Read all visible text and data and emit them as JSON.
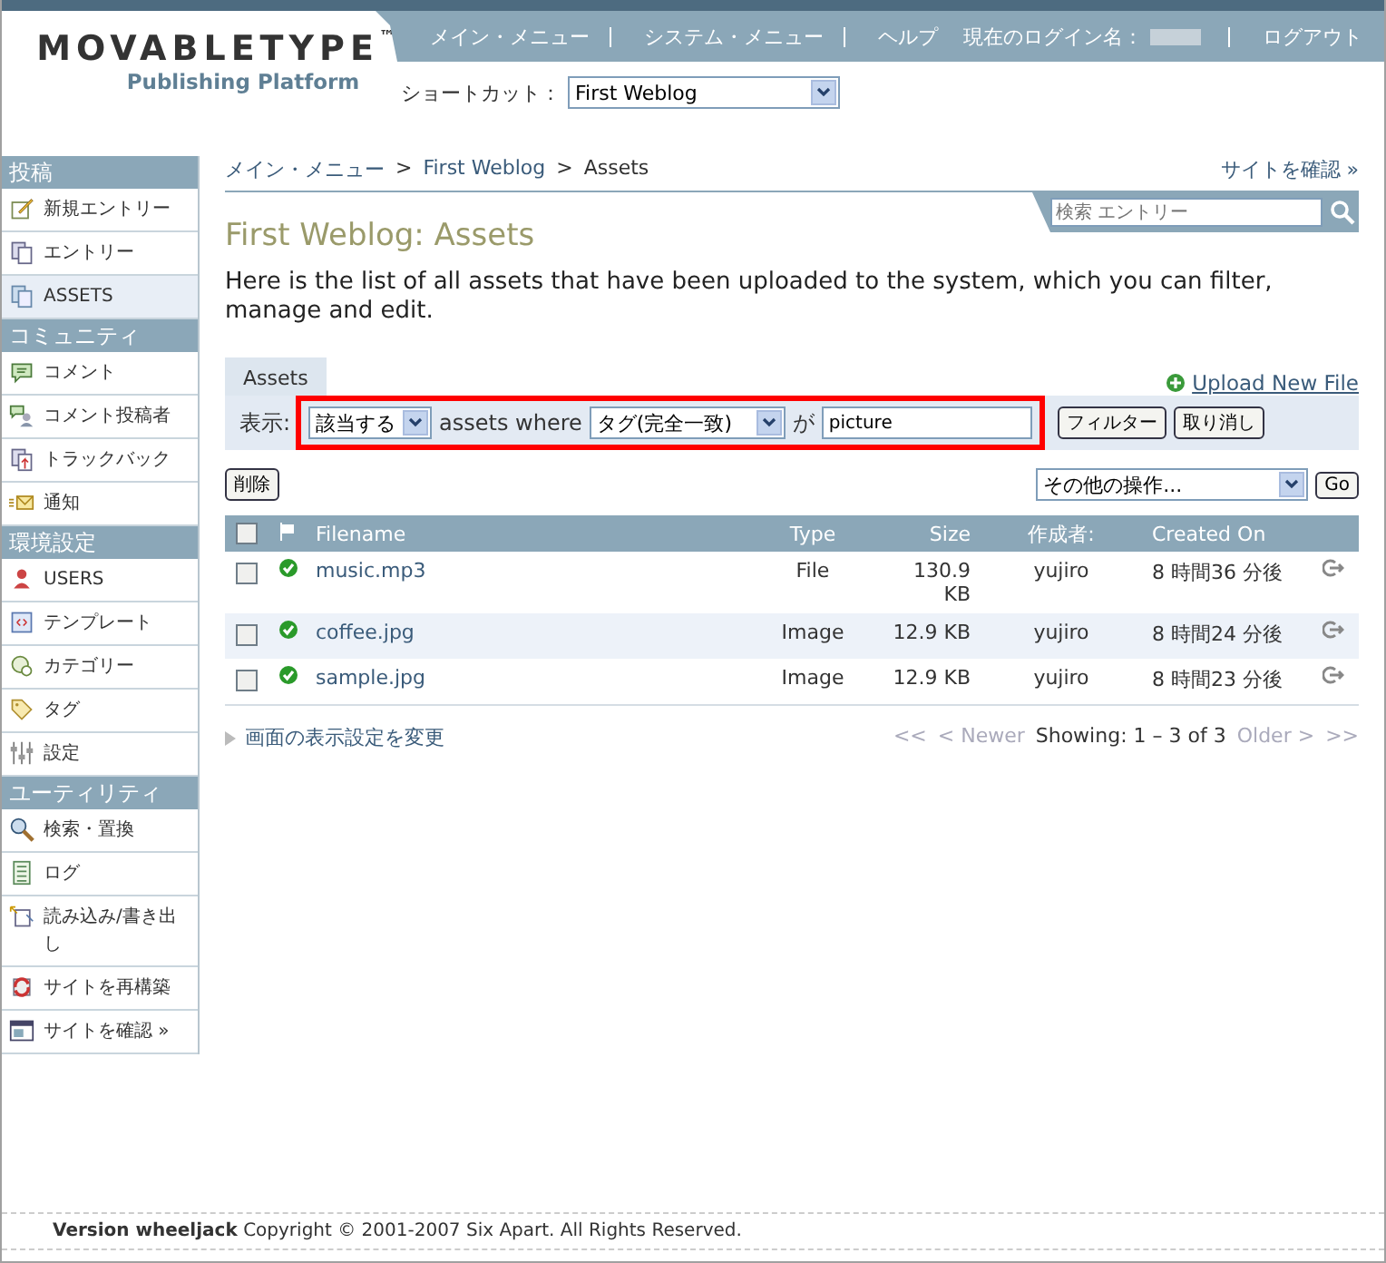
{
  "header": {
    "logo_title": "MOVABLETYPE",
    "logo_tm": "™",
    "logo_subtitle": "Publishing Platform",
    "nav": [
      "メイン・メニュー",
      "システム・メニュー",
      "ヘルプ"
    ],
    "login_label": "現在のログイン名：",
    "logout": "ログアウト",
    "shortcut_label": "ショートカット：",
    "shortcut_value": "First Weblog"
  },
  "sidebar": [
    {
      "title": "投稿",
      "items": [
        {
          "label": "新規エントリー",
          "selected": false
        },
        {
          "label": "エントリー",
          "selected": false
        },
        {
          "label": "ASSETS",
          "selected": true
        }
      ]
    },
    {
      "title": "コミュニティ",
      "items": [
        {
          "label": "コメント",
          "selected": false
        },
        {
          "label": "コメント投稿者",
          "selected": false
        },
        {
          "label": "トラックバック",
          "selected": false
        },
        {
          "label": "通知",
          "selected": false
        }
      ]
    },
    {
      "title": "環境設定",
      "items": [
        {
          "label": "USERS",
          "selected": false
        },
        {
          "label": "テンプレート",
          "selected": false
        },
        {
          "label": "カテゴリー",
          "selected": false
        },
        {
          "label": "タグ",
          "selected": false
        },
        {
          "label": "設定",
          "selected": false
        }
      ]
    },
    {
      "title": "ユーティリティ",
      "items": [
        {
          "label": "検索・置換",
          "selected": false
        },
        {
          "label": "ログ",
          "selected": false
        },
        {
          "label": "読み込み/書き出し",
          "selected": false
        },
        {
          "label": "サイトを再構築",
          "selected": false
        },
        {
          "label": "サイトを確認 »",
          "selected": false
        }
      ]
    }
  ],
  "breadcrumb": [
    "メイン・メニュー",
    "First Weblog",
    "Assets"
  ],
  "breadcrumb_sep": ">",
  "view_site": "サイトを確認 »",
  "search": {
    "placeholder": "検索 エントリー"
  },
  "page_title": "First Weblog: Assets",
  "intro": "Here is the list of all assets that have been uploaded to the system, which you can filter, manage and edit.",
  "tab": "Assets",
  "upload": "Upload New File",
  "filter": {
    "label": "表示:",
    "match": "該当する",
    "middle": "assets where",
    "field": "タグ(完全一致)",
    "ga": "が",
    "value": "picture",
    "apply": "フィルター",
    "cancel": "取り消し"
  },
  "delete": "削除",
  "more_actions": "その他の操作...",
  "go": "Go",
  "table": {
    "select_all_checked": false,
    "columns": [
      "Filename",
      "Type",
      "Size",
      "作成者:",
      "Created On"
    ],
    "rows": [
      {
        "checked": false,
        "filename": "music.mp3",
        "type": "File",
        "size": "130.9 KB",
        "author": "yujiro",
        "created": "8 時間36 分後"
      },
      {
        "checked": false,
        "filename": "coffee.jpg",
        "type": "Image",
        "size": "12.9 KB",
        "author": "yujiro",
        "created": "8 時間24 分後"
      },
      {
        "checked": false,
        "filename": "sample.jpg",
        "type": "Image",
        "size": "12.9 KB",
        "author": "yujiro",
        "created": "8 時間23 分後"
      }
    ]
  },
  "display_settings": "画面の表示設定を変更",
  "pager": {
    "first": "<<",
    "prev": "< Newer",
    "showing": "Showing: 1 – 3 of 3",
    "next": "Older >",
    "last": ">>"
  },
  "footer": {
    "version": "Version wheeljack",
    "copyright": "Copyright © 2001-2007 Six Apart. All Rights Reserved."
  }
}
